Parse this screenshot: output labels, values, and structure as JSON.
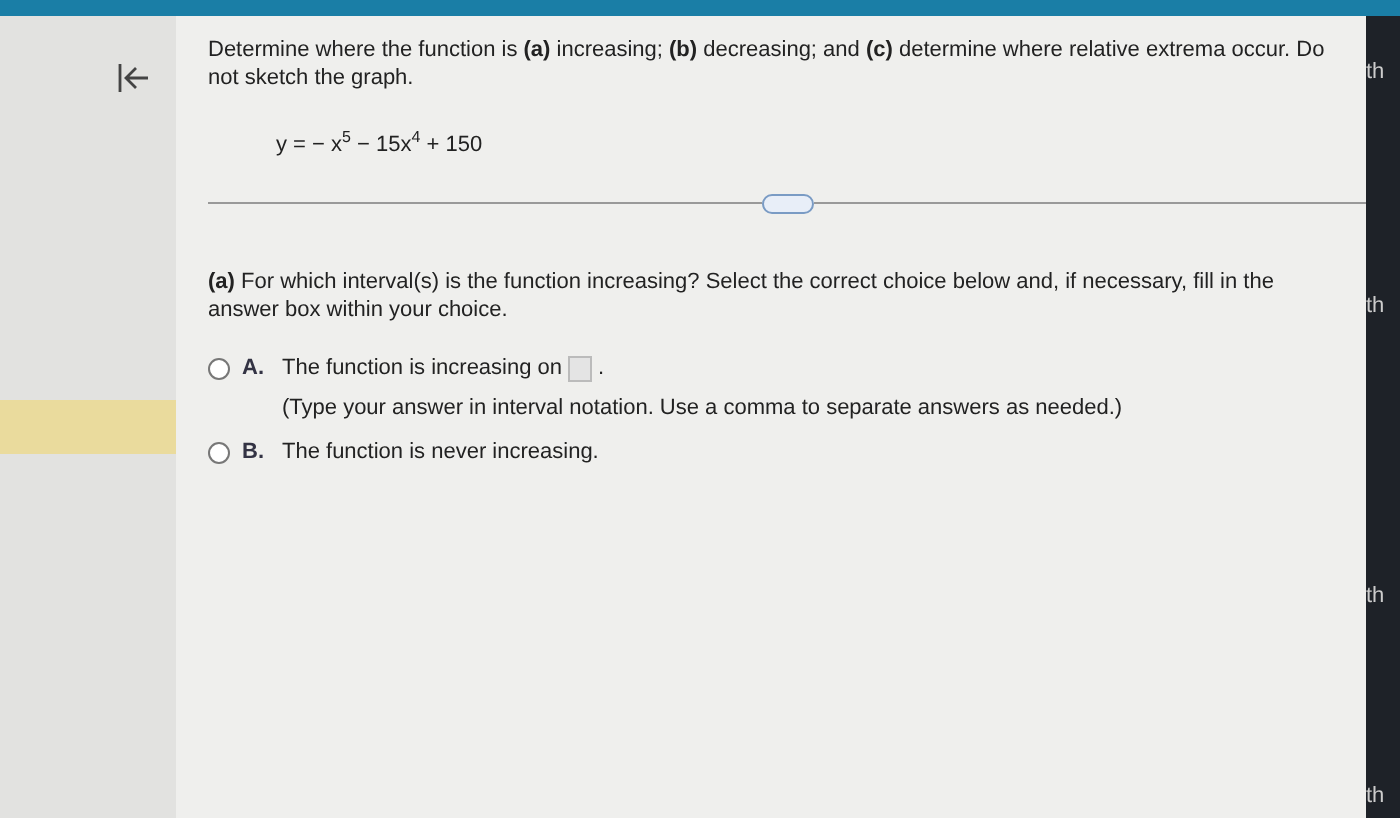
{
  "question": {
    "prompt": "Determine where the function is **(a)** increasing; **(b)** decreasing; and **(c)** determine where relative extrema occur. Do not sketch the graph.",
    "equation": "y = − x$^{5}$ − 15x$^{4}$ + 150"
  },
  "part": {
    "prompt": "**(a)** For which interval(s) is the function increasing? Select the correct choice below and, if necessary, fill in the answer box within your choice.",
    "choices": [
      {
        "letter": "A.",
        "kind": "answer-box",
        "before": "The function is increasing on",
        "after": ".",
        "hint": "(Type your answer in interval notation. Use a comma to separate answers as needed.)",
        "selected": false
      },
      {
        "letter": "B.",
        "kind": "plain",
        "text": "The function is never increasing.",
        "selected": false
      }
    ]
  },
  "side_fragments": [
    "th",
    "th",
    "th",
    "th"
  ]
}
